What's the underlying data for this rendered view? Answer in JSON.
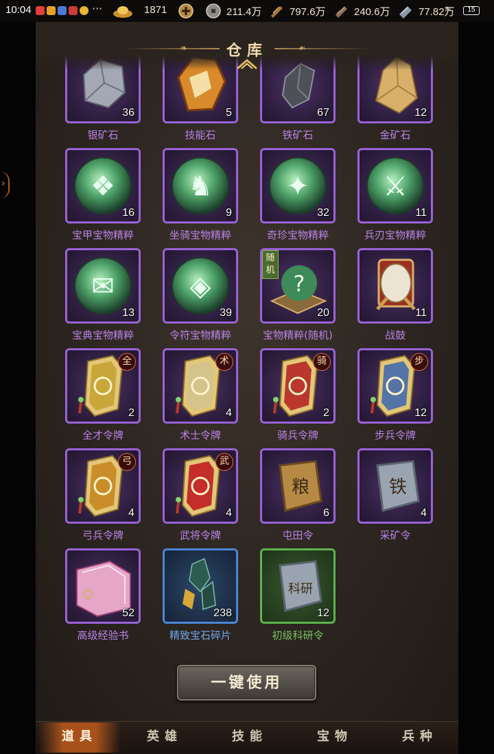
{
  "status": {
    "time": "10:04",
    "battery": "15"
  },
  "resources": [
    {
      "icon": "gold-ingot-icon",
      "value": "1871"
    },
    {
      "icon": "coin-icon",
      "value": "211.4万"
    },
    {
      "icon": "wood-icon",
      "value": "797.6万"
    },
    {
      "icon": "ore-icon",
      "value": "240.6万"
    },
    {
      "icon": "iron-icon",
      "value": "77.82万"
    }
  ],
  "panel": {
    "title": "仓库"
  },
  "items": [
    {
      "name": "银矿石",
      "count": "36",
      "icon": "silver-ore-icon",
      "rarity": "purple"
    },
    {
      "name": "技能石",
      "count": "5",
      "icon": "skill-stone-icon",
      "rarity": "purple"
    },
    {
      "name": "铁矿石",
      "count": "67",
      "icon": "iron-ore-icon",
      "rarity": "purple"
    },
    {
      "name": "金矿石",
      "count": "12",
      "icon": "gold-ore-icon",
      "rarity": "purple"
    },
    {
      "name": "宝甲宝物精粹",
      "count": "16",
      "icon": "armor-essence-orb-icon",
      "rarity": "purple"
    },
    {
      "name": "坐骑宝物精粹",
      "count": "9",
      "icon": "mount-essence-orb-icon",
      "rarity": "purple"
    },
    {
      "name": "奇珍宝物精粹",
      "count": "32",
      "icon": "rare-essence-orb-icon",
      "rarity": "purple"
    },
    {
      "name": "兵刃宝物精粹",
      "count": "11",
      "icon": "weapon-essence-orb-icon",
      "rarity": "purple"
    },
    {
      "name": "宝典宝物精粹",
      "count": "13",
      "icon": "book-essence-orb-icon",
      "rarity": "purple"
    },
    {
      "name": "令符宝物精粹",
      "count": "39",
      "icon": "token-essence-orb-icon",
      "rarity": "purple"
    },
    {
      "name": "宝物精粹(随机)",
      "count": "20",
      "icon": "random-essence-icon",
      "rarity": "purple",
      "tag": "随机"
    },
    {
      "name": "战鼓",
      "count": "11",
      "icon": "war-drum-icon",
      "rarity": "purple"
    },
    {
      "name": "全才令牌",
      "count": "2",
      "icon": "allround-token-icon",
      "rarity": "purple",
      "badge": "全",
      "plate": "#c9a63a"
    },
    {
      "name": "术士令牌",
      "count": "4",
      "icon": "sorcerer-token-icon",
      "rarity": "purple",
      "badge": "术",
      "plate": "#d4c38a"
    },
    {
      "name": "骑兵令牌",
      "count": "2",
      "icon": "cavalry-token-icon",
      "rarity": "purple",
      "badge": "骑",
      "plate": "#b9372d"
    },
    {
      "name": "步兵令牌",
      "count": "12",
      "icon": "infantry-token-icon",
      "rarity": "purple",
      "badge": "步",
      "plate": "#5474a8"
    },
    {
      "name": "弓兵令牌",
      "count": "4",
      "icon": "archer-token-icon",
      "rarity": "purple",
      "badge": "弓",
      "plate": "#c98e2a"
    },
    {
      "name": "武将令牌",
      "count": "4",
      "icon": "general-token-icon",
      "rarity": "purple",
      "badge": "武",
      "plate": "#c42e2a"
    },
    {
      "name": "屯田令",
      "count": "6",
      "icon": "farming-order-icon",
      "rarity": "purple",
      "seal": "粮"
    },
    {
      "name": "采矿令",
      "count": "4",
      "icon": "mining-order-icon",
      "rarity": "purple",
      "seal": "铁"
    },
    {
      "name": "高级经验书",
      "count": "52",
      "icon": "exp-book-icon",
      "rarity": "purple"
    },
    {
      "name": "精致宝石碎片",
      "count": "238",
      "icon": "gem-fragment-icon",
      "rarity": "blue"
    },
    {
      "name": "初级科研令",
      "count": "12",
      "icon": "research-order-icon",
      "rarity": "green",
      "seal": "科研"
    }
  ],
  "use_all_button": "一键使用",
  "tabs": [
    {
      "label": "道具",
      "active": true
    },
    {
      "label": "英雄",
      "active": false
    },
    {
      "label": "技能",
      "active": false
    },
    {
      "label": "宝物",
      "active": false
    },
    {
      "label": "兵种",
      "active": false
    }
  ]
}
